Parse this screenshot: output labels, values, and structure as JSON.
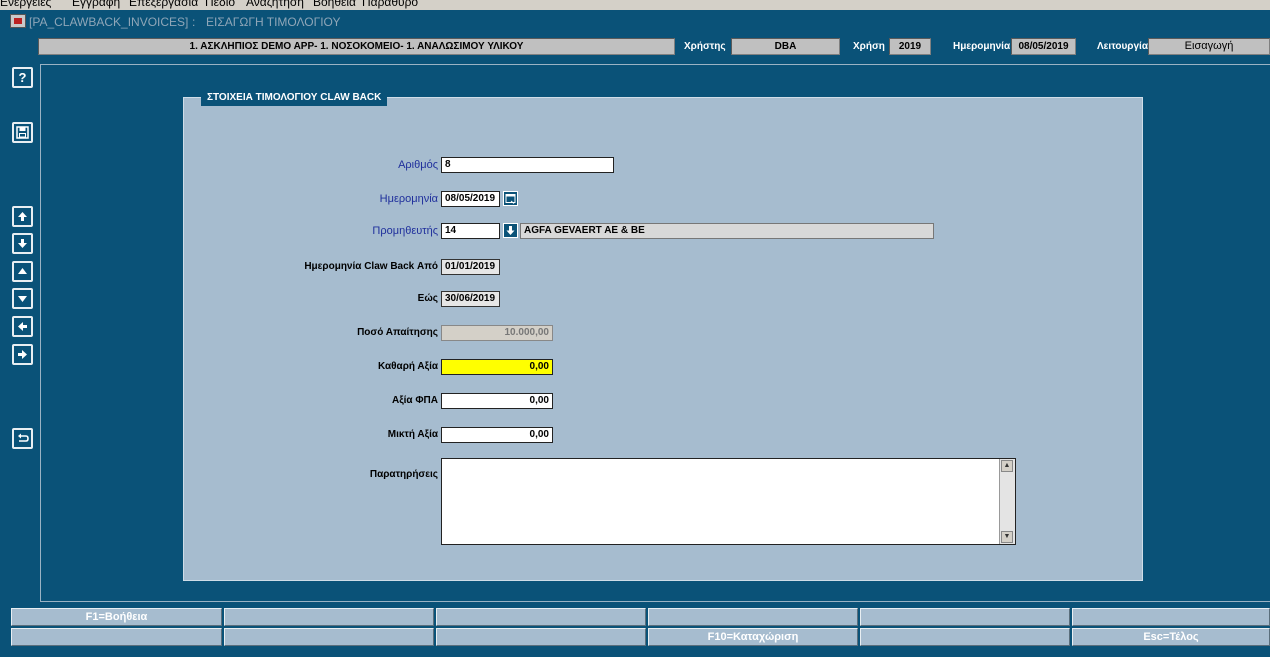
{
  "menu": [
    "Ενέργειες",
    "Εγγραφή",
    "Επεξεργασία",
    "Πεδίο",
    "Αναζήτηση",
    "Βοήθεια",
    "Παράθυρο"
  ],
  "window": {
    "module": "[PA_CLAWBACK_INVOICES]",
    "separator": ":",
    "title": "ΕΙΣΑΓΩΓΗ ΤΙΜΟΛΟΓΙΟΥ"
  },
  "header": {
    "app": "1. ΑΣΚΛΗΠΙΟΣ DEMO APP- 1. ΝΟΣΟΚΟΜΕΙΟ- 1. ΑΝΑΛΩΣΙΜΟΥ ΥΛΙΚΟΥ",
    "user_label": "Χρήστης",
    "user": "DBA",
    "year_label": "Χρήση",
    "year": "2019",
    "date_label": "Ημερομηνία",
    "date": "08/05/2019",
    "mode_label": "Λειτουργία",
    "mode": "Εισαγωγή"
  },
  "toolbar": {
    "help": "?",
    "save": "💾",
    "up": "⬆",
    "down": "⬇",
    "first": "⏶",
    "last": "⏷",
    "prev": "⬅",
    "next": "➡",
    "undo": "⮌"
  },
  "panel": {
    "title": "ΣΤΟΙΧΕΙΑ ΤΙΜΟΛΟΓΙΟΥ CLAW BACK"
  },
  "form": {
    "number_label": "Αριθμός",
    "number": "8",
    "date_label": "Ημερομηνία",
    "date": "08/05/2019",
    "supplier_label": "Προμηθευτής",
    "supplier_code": "14",
    "supplier_name": "AGFA GEVAERT AE & BE",
    "cb_from_label": "Ημερομηνία Claw Back Από",
    "cb_from": "01/01/2019",
    "cb_to_label": "Εώς",
    "cb_to": "30/06/2019",
    "claim_label": "Ποσό Απαίτησης",
    "claim": "10.000,00",
    "net_label": "Καθαρή Αξία",
    "net": "0,00",
    "vat_label": "Αξία ΦΠΑ",
    "vat": "0,00",
    "gross_label": "Μικτή Αξία",
    "gross": "0,00",
    "notes_label": "Παρατηρήσεις",
    "notes": ""
  },
  "function_keys": {
    "row1": [
      "F1=Βοήθεια",
      "",
      "",
      "",
      "",
      ""
    ],
    "row2": [
      "",
      "",
      "",
      "F10=Καταχώριση",
      "",
      "Esc=Τέλος"
    ]
  },
  "colors": {
    "background": "#0a5278",
    "panel": "#a6bccf",
    "highlight_field": "#ffff00",
    "required_label": "#1f2f9c"
  }
}
